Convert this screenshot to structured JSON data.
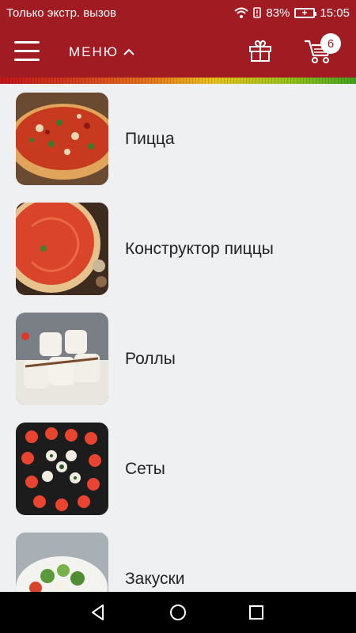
{
  "status": {
    "carrier": "Только экстр. вызов",
    "battery": "83%",
    "time": "15:05"
  },
  "header": {
    "menu_label": "МЕНЮ",
    "cart_count": "6"
  },
  "categories": [
    {
      "label": "Пицца"
    },
    {
      "label": "Конструктор пиццы"
    },
    {
      "label": "Роллы"
    },
    {
      "label": "Сеты"
    },
    {
      "label": "Закуски"
    }
  ],
  "colors": {
    "brand": "#a11b22",
    "background": "#eef0f2"
  },
  "icons": [
    "menu-icon",
    "chevron-up-icon",
    "gift-icon",
    "cart-icon",
    "wifi-icon",
    "battery-icon",
    "back-icon",
    "home-icon",
    "recents-icon"
  ]
}
